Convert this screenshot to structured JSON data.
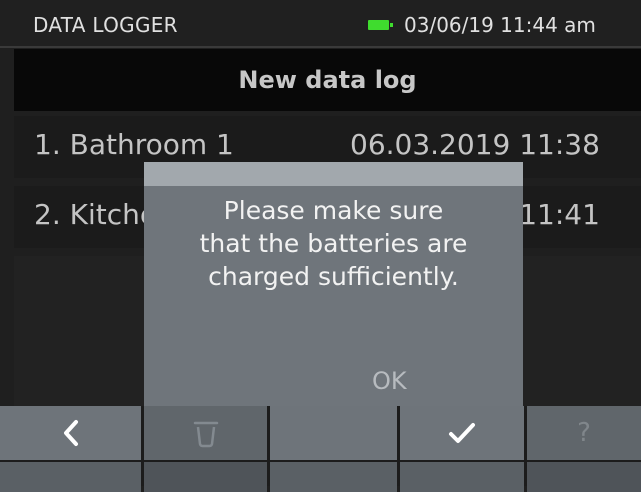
{
  "status_bar": {
    "title": "DATA LOGGER",
    "datetime": "03/06/19 11:44 am",
    "battery_color": "#3fdc2e"
  },
  "header": {
    "title": "New data log"
  },
  "logs": [
    {
      "name": "1. Bathroom 1",
      "timestamp": "06.03.2019 11:38"
    },
    {
      "name": "2. Kitchen",
      "timestamp": "06.03.2019 11:41"
    }
  ],
  "dialog": {
    "message_lines": [
      "Please make sure",
      "that the batteries are",
      "charged sufficiently."
    ],
    "ok_label": "OK"
  },
  "footer": {
    "buttons": [
      {
        "name": "back",
        "icon": "chevron-left-icon",
        "enabled": true
      },
      {
        "name": "delete",
        "icon": "trash-icon",
        "enabled": false
      },
      {
        "name": "blank",
        "icon": "",
        "enabled": true
      },
      {
        "name": "confirm",
        "icon": "checkmark-icon",
        "enabled": true
      },
      {
        "name": "help",
        "icon": "question-icon",
        "label": "?",
        "enabled": false
      }
    ]
  }
}
